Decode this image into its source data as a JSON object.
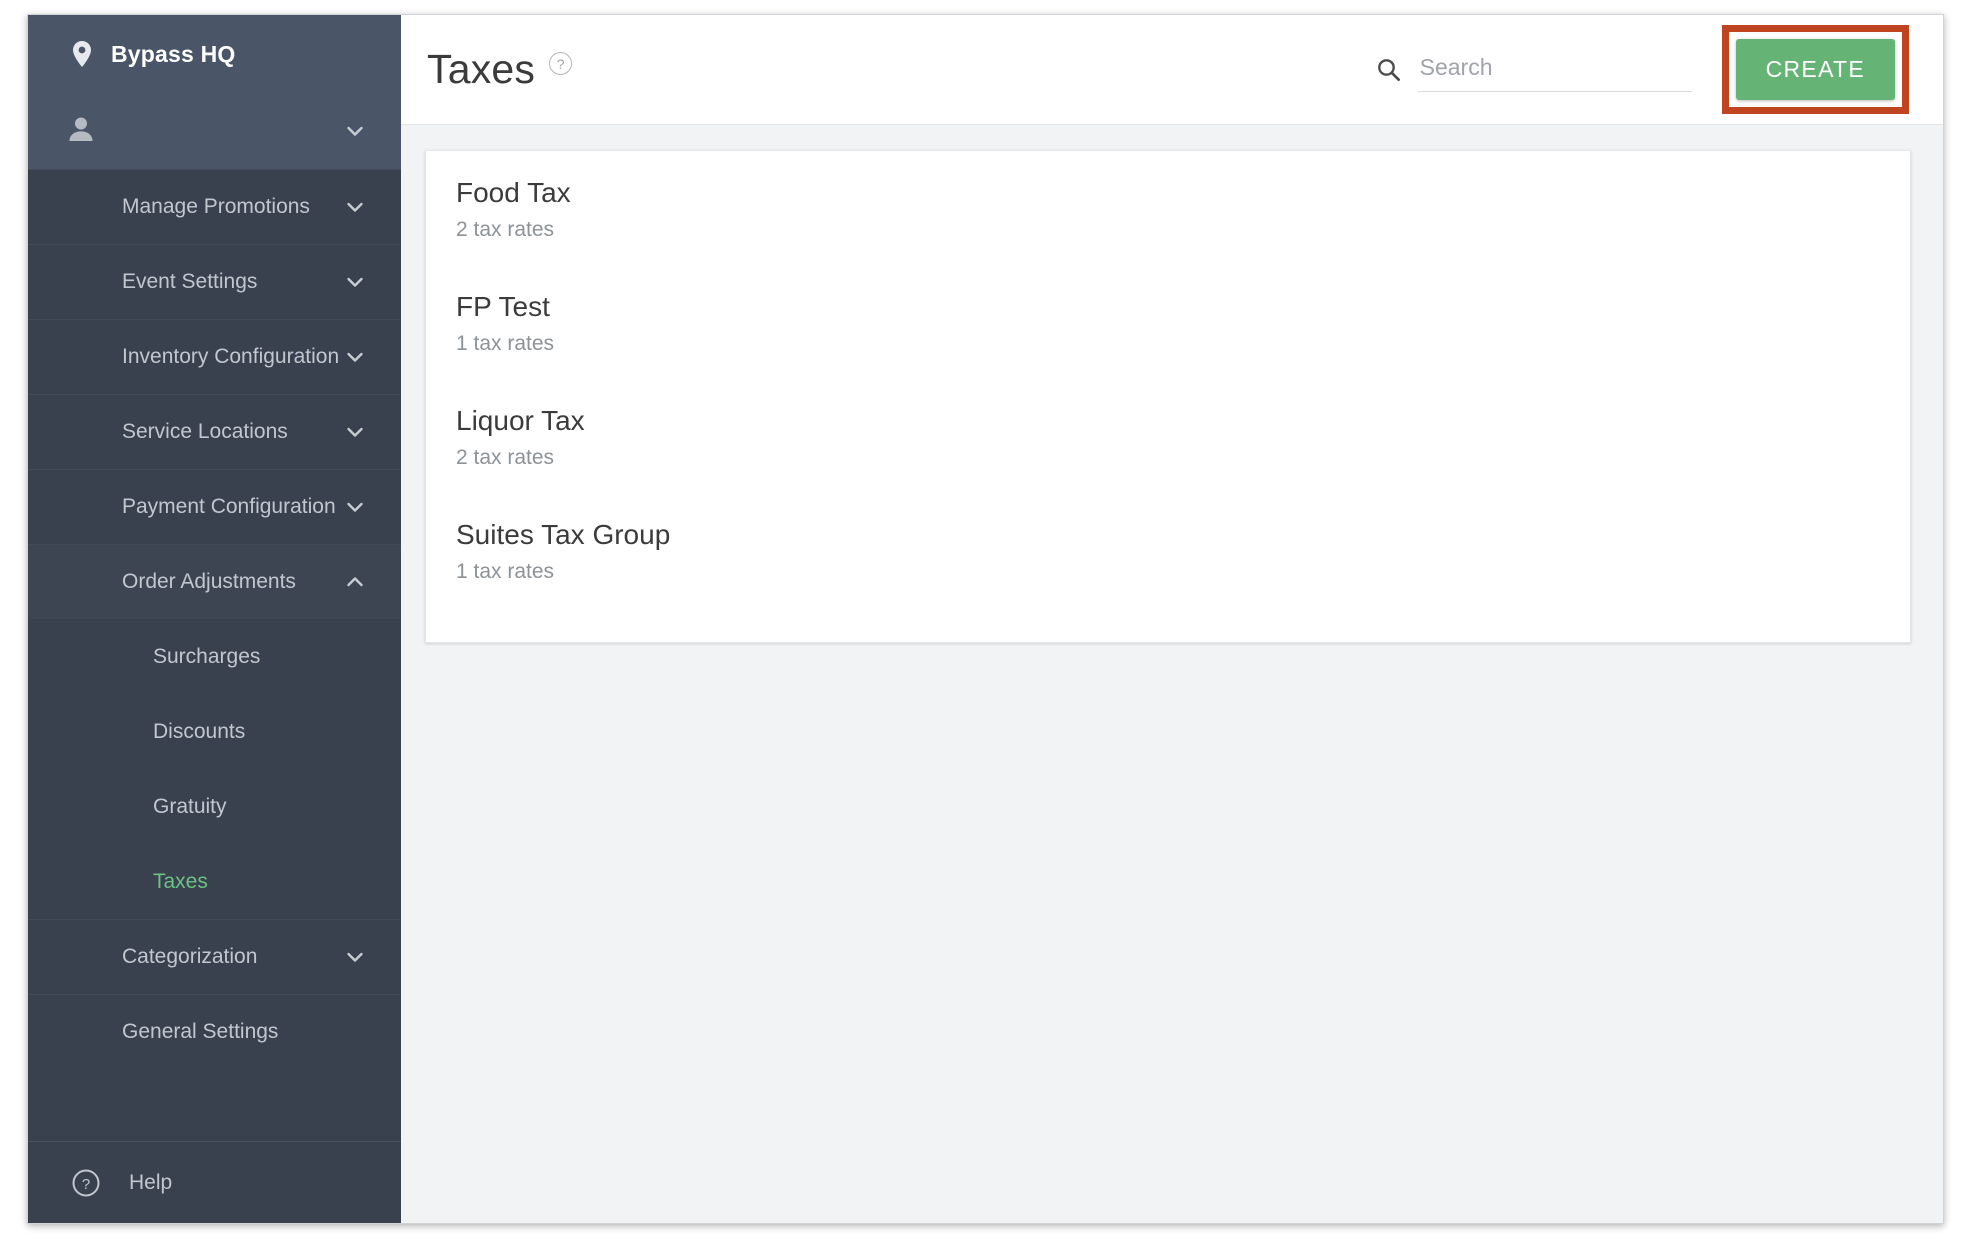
{
  "sidebar": {
    "brand": {
      "label": "Bypass HQ",
      "icon": "location-pin-icon"
    },
    "user": {
      "label": "",
      "icon": "person-icon",
      "chevron": "chevron-down-icon"
    },
    "clipped_item_above": {
      "label": ""
    },
    "nav_groups": [
      {
        "label": "Manage Promotions",
        "chevron": "chevron-down-icon",
        "expanded": false
      },
      {
        "label": "Event Settings",
        "chevron": "chevron-down-icon",
        "expanded": false
      },
      {
        "label": "Inventory Configuration",
        "chevron": "chevron-down-icon",
        "expanded": false
      },
      {
        "label": "Service Locations",
        "chevron": "chevron-down-icon",
        "expanded": false
      },
      {
        "label": "Payment Configuration",
        "chevron": "chevron-down-icon",
        "expanded": false
      },
      {
        "label": "Order Adjustments",
        "chevron": "chevron-up-icon",
        "expanded": true
      }
    ],
    "order_adjustments_children": [
      {
        "label": "Surcharges",
        "active": false
      },
      {
        "label": "Discounts",
        "active": false
      },
      {
        "label": "Gratuity",
        "active": false
      },
      {
        "label": "Taxes",
        "active": true
      }
    ],
    "nav_groups_after": [
      {
        "label": "Categorization",
        "chevron": "chevron-down-icon",
        "expanded": false
      },
      {
        "label": "General Settings",
        "chevron": "",
        "expanded": false
      }
    ],
    "help": {
      "label": "Help",
      "icon": "question-circle-icon"
    },
    "colors": {
      "background": "#39414f",
      "header_background": "#4a5568",
      "text": "#c2c7cf",
      "active_text": "#6cc184"
    }
  },
  "header": {
    "title": "Taxes",
    "help_icon_glyph": "?",
    "search": {
      "placeholder": "Search",
      "value": "",
      "icon": "search-icon"
    },
    "create_button": {
      "label": "CREATE",
      "color": "#66b475",
      "highlight_color": "#c0441f"
    }
  },
  "main": {
    "tax_groups": [
      {
        "name": "Food Tax",
        "rates": "2 tax rates"
      },
      {
        "name": "FP Test",
        "rates": "1 tax rates"
      },
      {
        "name": "Liquor Tax",
        "rates": "2 tax rates"
      },
      {
        "name": "Suites Tax Group",
        "rates": "1 tax rates"
      }
    ]
  }
}
